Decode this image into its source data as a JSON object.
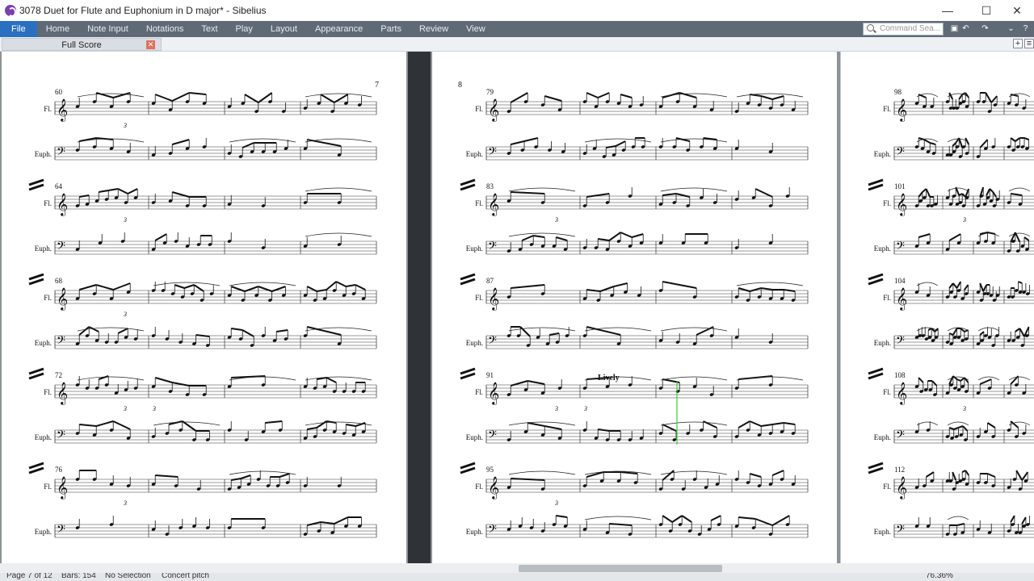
{
  "window": {
    "title": "3078 Duet for Flute and Euphonium in D major* - Sibelius",
    "minimize": "—",
    "maximize": "☐",
    "close": "✕"
  },
  "ribbon": {
    "tabs": [
      "File",
      "Home",
      "Note Input",
      "Notations",
      "Text",
      "Play",
      "Layout",
      "Appearance",
      "Parts",
      "Review",
      "View"
    ],
    "search_placeholder": "Command Sea...",
    "accent": "#2a6fc0"
  },
  "doc_tab": {
    "label": "Full Score",
    "close": "✕"
  },
  "tab_buttons": {
    "add": "+",
    "menu": "≡"
  },
  "pages": [
    {
      "page_number": "",
      "top_right_number": "7",
      "systems": [
        {
          "measure": "60",
          "flute": "Fl.",
          "euph": "Euph.",
          "tuplets": [
            "3"
          ]
        },
        {
          "measure": "64",
          "flute": "Fl.",
          "euph": "Euph.",
          "tuplets": [
            "3"
          ]
        },
        {
          "measure": "68",
          "flute": "Fl.",
          "euph": "Euph.",
          "tuplets": [
            "3"
          ]
        },
        {
          "measure": "72",
          "flute": "Fl.",
          "euph": "Euph.",
          "tuplets": [
            "3",
            "3"
          ]
        },
        {
          "measure": "76",
          "flute": "Fl.",
          "euph": "Euph.",
          "tuplets": [
            "3"
          ]
        }
      ]
    },
    {
      "page_number": "8",
      "top_right_number": "",
      "systems": [
        {
          "measure": "79",
          "flute": "Fl.",
          "euph": "Euph.",
          "tuplets": []
        },
        {
          "measure": "83",
          "flute": "Fl.",
          "euph": "Euph.",
          "tuplets": [
            "3"
          ]
        },
        {
          "measure": "87",
          "flute": "Fl.",
          "euph": "Euph.",
          "tuplets": []
        },
        {
          "measure": "91",
          "flute": "Fl.",
          "euph": "Euph.",
          "tuplets": [
            "3",
            "3"
          ],
          "tempo": "Lively"
        },
        {
          "measure": "95",
          "flute": "Fl.",
          "euph": "Euph.",
          "tuplets": [
            "3"
          ]
        }
      ]
    },
    {
      "page_number": "",
      "top_right_number": "",
      "systems": [
        {
          "measure": "98",
          "flute": "Fl.",
          "euph": "Euph.",
          "tuplets": []
        },
        {
          "measure": "101",
          "flute": "Fl.",
          "euph": "Euph.",
          "tuplets": [
            "3"
          ]
        },
        {
          "measure": "104",
          "flute": "Fl.",
          "euph": "Euph.",
          "tuplets": []
        },
        {
          "measure": "108",
          "flute": "Fl.",
          "euph": "Euph.",
          "tuplets": [
            "3"
          ]
        },
        {
          "measure": "112",
          "flute": "Fl.",
          "euph": "Euph.",
          "tuplets": []
        }
      ]
    }
  ],
  "status": {
    "page": "Page 7 of 12",
    "bars": "Bars: 154",
    "selection": "No Selection",
    "pitch": "Concert pitch",
    "zoom": "76.36%"
  }
}
